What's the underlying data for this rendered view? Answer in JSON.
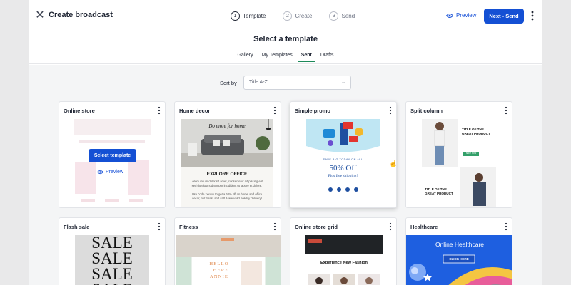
{
  "header": {
    "title": "Create broadcast",
    "steps": [
      {
        "num": "1",
        "label": "Template"
      },
      {
        "num": "2",
        "label": "Create"
      },
      {
        "num": "3",
        "label": "Send"
      }
    ],
    "preview_label": "Preview",
    "next_label": "Next - Send"
  },
  "page": {
    "heading": "Select a template",
    "tabs": [
      "Gallery",
      "My Templates",
      "Sent",
      "Drafts"
    ],
    "active_tab": "Sent"
  },
  "sort": {
    "label": "Sort by",
    "value": "Title A-Z"
  },
  "cards": [
    {
      "title": "Online store",
      "select_label": "Select template",
      "preview_label": "Preview"
    },
    {
      "title": "Home decor",
      "headline": "Do more for home",
      "sub": "EXPLORE OFFICE",
      "body": "Lorem ipsum dolor sit amet, consectetur adipiscing elit, sed do eiusmod tempor incididunt ut labore et dolore.",
      "body2": "Use code xxxxxx to get a 60% off on home and office decor, out forest and salt & are valid holiday delivery!"
    },
    {
      "title": "Simple promo",
      "kicker": "SAVE BIG TODAY ON ALL",
      "offer": "50% Off",
      "offer_sub": "Plus free shipping!"
    },
    {
      "title": "Split column",
      "product1": "TITLE OF THE GREAT PRODUCT",
      "product2": "TITLE OF THE GREAT PRODUCT",
      "shop": "SHOP NOW"
    },
    {
      "title": "Flash sale",
      "word": "SALE"
    },
    {
      "title": "Fitness",
      "hello": "HELLO THERE ANNIE"
    },
    {
      "title": "Online store grid",
      "headline": "Experience New Fashion"
    },
    {
      "title": "Healthcare",
      "headline": "Online Healthcare",
      "cta": "CLICK HERE"
    }
  ],
  "colors": {
    "primary": "#1450d4",
    "accent_green": "#1d8a5a",
    "health_blue": "#1e5fe0"
  }
}
